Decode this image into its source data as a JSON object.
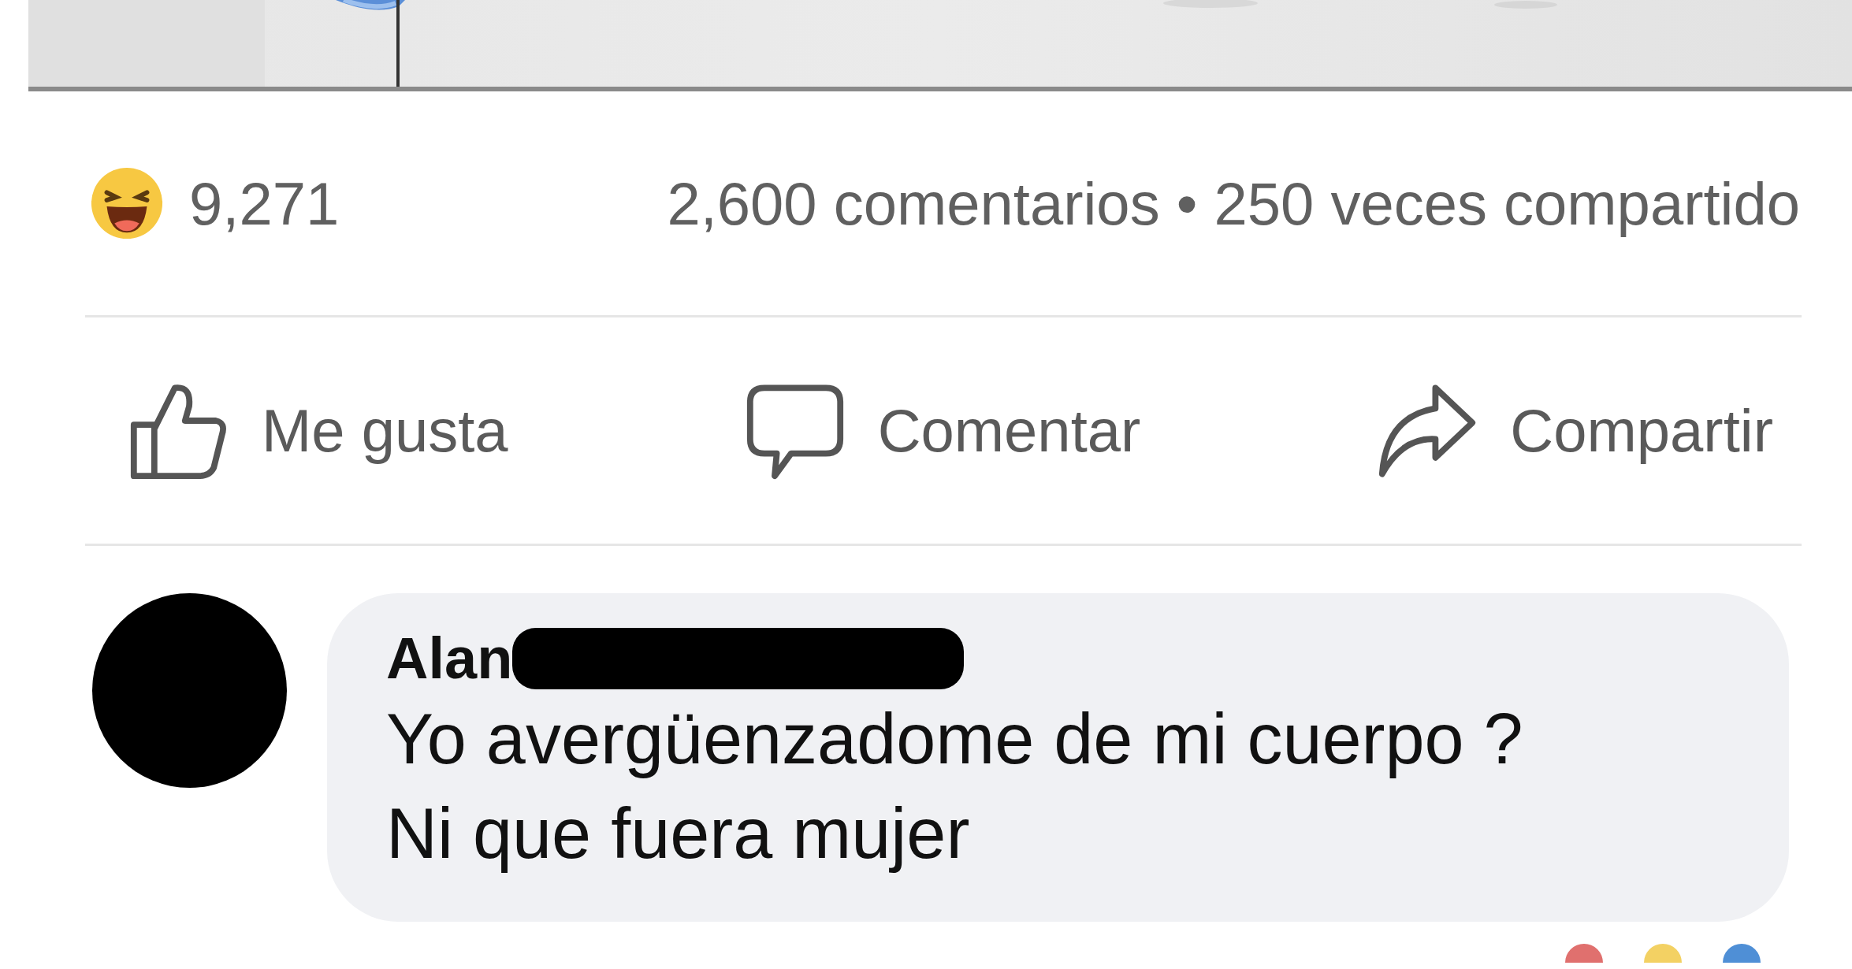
{
  "stats": {
    "reaction_count": "9,271",
    "summary": "2,600 comentarios • 250 veces compartido"
  },
  "actions": [
    {
      "kind": "like",
      "label": "Me gusta"
    },
    {
      "kind": "comment",
      "label": "Comentar"
    },
    {
      "kind": "share",
      "label": "Compartir"
    }
  ],
  "comment": {
    "author": "Alan",
    "author_redacted": true,
    "text": "Yo avergüenzadome de mi cuerpo ?\nNi que fuera mujer"
  }
}
